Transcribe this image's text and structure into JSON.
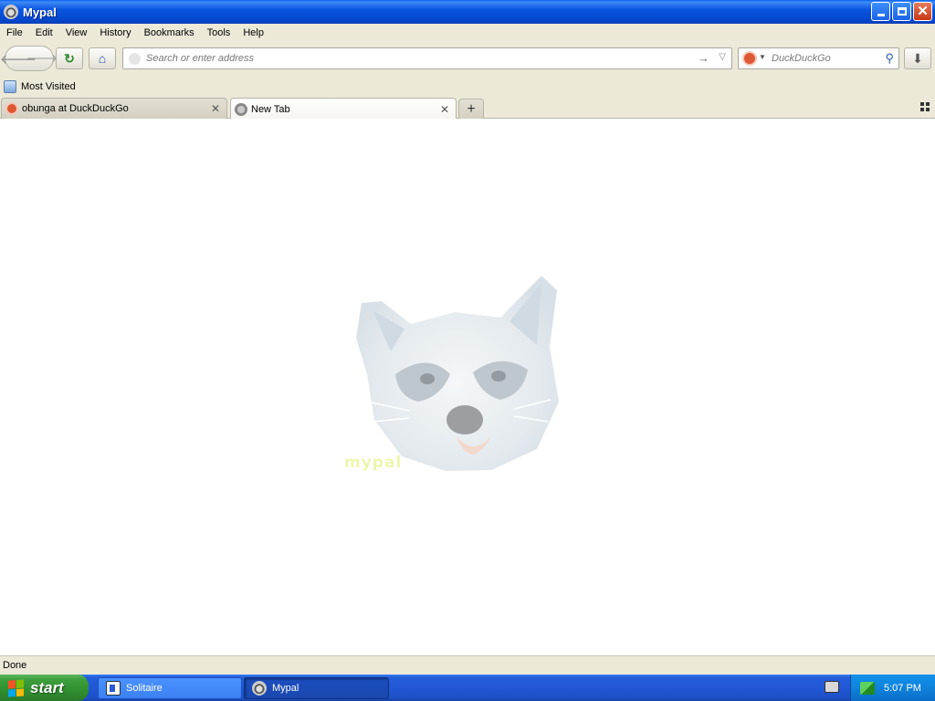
{
  "window": {
    "title": "Mypal"
  },
  "menubar": {
    "items": [
      "File",
      "Edit",
      "View",
      "History",
      "Bookmarks",
      "Tools",
      "Help"
    ]
  },
  "navbar": {
    "url_placeholder": "Search or enter address",
    "search_placeholder": "DuckDuckGo"
  },
  "bookmarks": {
    "items": [
      "Most Visited"
    ]
  },
  "tabs": [
    {
      "title": "obunga at DuckDuckGo",
      "active": false
    },
    {
      "title": "New Tab",
      "active": true
    }
  ],
  "content": {
    "brand_mark": "mypal"
  },
  "status": {
    "text": "Done"
  },
  "taskbar": {
    "start_label": "start",
    "tasks": [
      "Solitaire",
      "Mypal"
    ],
    "clock": "5:07 PM"
  }
}
